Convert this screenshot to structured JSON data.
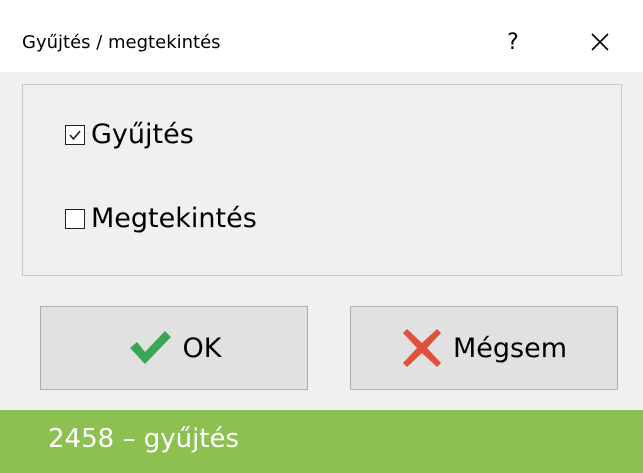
{
  "dialog": {
    "title": "Gyűjtés / megtekintés",
    "help_glyph": "?",
    "options": [
      {
        "label": "Gyűjtés",
        "checked": true
      },
      {
        "label": "Megtekintés",
        "checked": false
      }
    ],
    "ok_label": "OK",
    "cancel_label": "Mégsem",
    "icons": {
      "ok": "checkmark-icon",
      "cancel": "cross-icon",
      "close": "close-icon"
    },
    "colors": {
      "ok_icon": "#3aa655",
      "cancel_icon": "#e0503a"
    }
  },
  "caption": {
    "text": "2458 – gyűjtés",
    "background": "#8cc152"
  }
}
